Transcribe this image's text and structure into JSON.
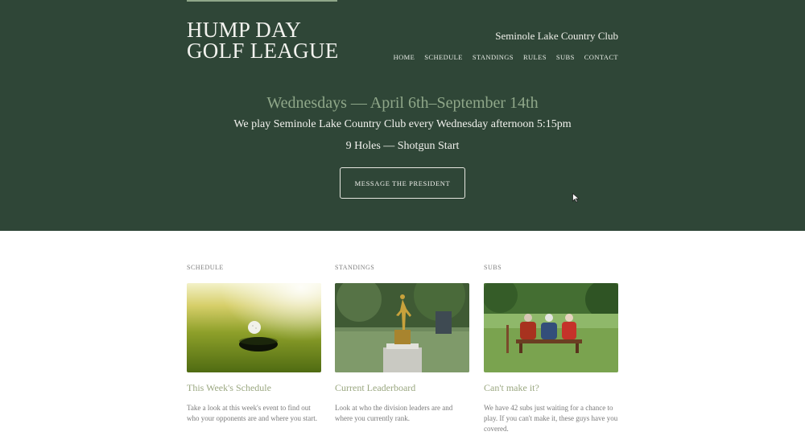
{
  "header": {
    "logo_line1": "HUMP DAY",
    "logo_line2": "GOLF LEAGUE",
    "club_name": "Seminole Lake Country Club",
    "nav": [
      "HOME",
      "SCHEDULE",
      "STANDINGS",
      "RULES",
      "SUBS",
      "CONTACT"
    ]
  },
  "hero": {
    "dates": "Wednesdays — April 6th–September 14th",
    "line1": "We play Seminole Lake Country Club every Wednesday afternoon 5:15pm",
    "line2": "9 Holes — Shotgun Start",
    "cta": "MESSAGE THE PRESIDENT"
  },
  "cards": [
    {
      "eyebrow": "SCHEDULE",
      "title": "This Week's Schedule",
      "desc": "Take a look at this week's event to find out who your opponents are and where you start."
    },
    {
      "eyebrow": "STANDINGS",
      "title": "Current Leaderboard",
      "desc": "Look at who the division leaders are and where you currently rank."
    },
    {
      "eyebrow": "SUBS",
      "title": "Can't make it?",
      "desc": "We have 42 subs just waiting for a chance to play. If you can't make it, these guys have you covered."
    }
  ],
  "colors": {
    "hero_bg": "#2f4637",
    "accent": "#8fa789"
  }
}
